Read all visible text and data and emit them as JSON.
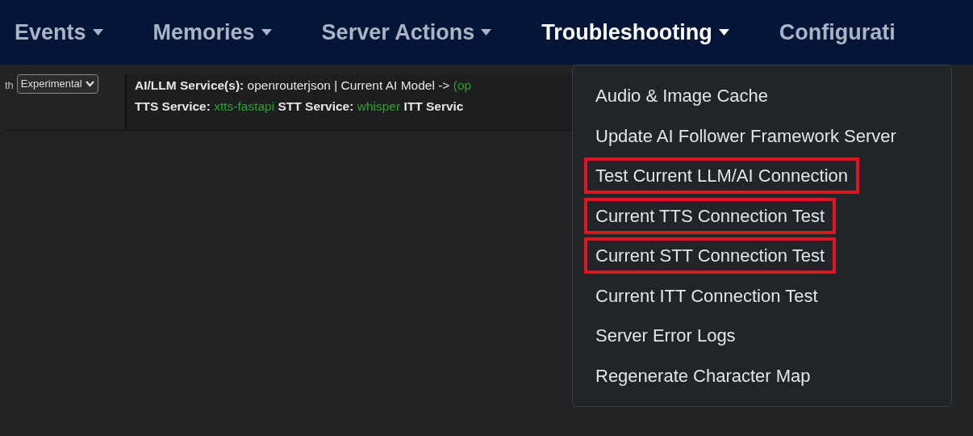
{
  "nav": [
    {
      "label": "Events",
      "selected": false,
      "caret": true
    },
    {
      "label": "Memories",
      "selected": false,
      "caret": true
    },
    {
      "label": "Server Actions",
      "selected": false,
      "caret": true
    },
    {
      "label": "Troubleshooting",
      "selected": true,
      "caret": true
    },
    {
      "label": "Configurati",
      "selected": false,
      "caret": false
    }
  ],
  "left_panel": {
    "label": "th",
    "select": "Experimental"
  },
  "status_lines": [
    [
      {
        "kind": "label",
        "text": "AI/LLM Service(s):"
      },
      {
        "kind": "text",
        "text": "openrouterjson | Current AI Model ->"
      },
      {
        "kind": "value",
        "text": "(op"
      }
    ],
    [
      {
        "kind": "label",
        "text": "TTS Service:"
      },
      {
        "kind": "value",
        "text": "xtts-fastapi"
      },
      {
        "kind": "label",
        "text": "STT Service:"
      },
      {
        "kind": "value",
        "text": "whisper"
      },
      {
        "kind": "label",
        "text": "ITT Servic"
      }
    ]
  ],
  "dropdown": [
    {
      "label": "Audio & Image Cache",
      "highlighted": false
    },
    {
      "label": "Update AI Follower Framework Server",
      "highlighted": false
    },
    {
      "label": "Test Current LLM/AI Connection",
      "highlighted": true
    },
    {
      "label": "Current TTS Connection Test",
      "highlighted": true
    },
    {
      "label": "Current STT Connection Test",
      "highlighted": true
    },
    {
      "label": "Current ITT Connection Test",
      "highlighted": false
    },
    {
      "label": "Server Error Logs",
      "highlighted": false
    },
    {
      "label": "Regenerate Character Map",
      "highlighted": false
    }
  ]
}
